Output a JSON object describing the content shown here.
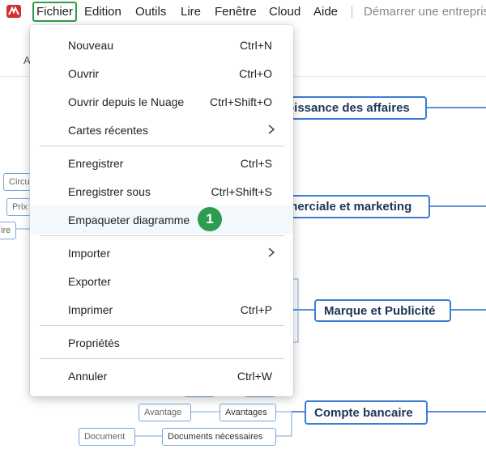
{
  "menubar": {
    "items": [
      "Fichier",
      "Edition",
      "Outils",
      "Lire",
      "Fenêtre",
      "Cloud",
      "Aide"
    ],
    "startup_text": "Démarrer une entreprise"
  },
  "toolbar": {
    "letter": "A"
  },
  "dropdown": {
    "items": [
      {
        "label": "Nouveau",
        "shortcut": "Ctrl+N"
      },
      {
        "label": "Ouvrir",
        "shortcut": "Ctrl+O"
      },
      {
        "label": "Ouvrir depuis le Nuage",
        "shortcut": "Ctrl+Shift+O"
      },
      {
        "label": "Cartes récentes",
        "shortcut": ""
      },
      {
        "label": "Enregistrer",
        "shortcut": "Ctrl+S"
      },
      {
        "label": "Enregistrer sous",
        "shortcut": "Ctrl+Shift+S"
      },
      {
        "label": "Empaqueter diagramme",
        "shortcut": ""
      },
      {
        "label": "Importer",
        "shortcut": ""
      },
      {
        "label": "Exporter",
        "shortcut": ""
      },
      {
        "label": "Imprimer",
        "shortcut": "Ctrl+P"
      },
      {
        "label": "Propriétés",
        "shortcut": ""
      },
      {
        "label": "Annuler",
        "shortcut": "Ctrl+W"
      }
    ],
    "badge": "1"
  },
  "mindmap": {
    "topic_business": "oissance des affaires",
    "topic_marketing": "merciale et marketing",
    "topic_brand": "Marque et Publicité",
    "topic_bank": "Compte bancaire",
    "leaf_circu": "Circu",
    "leaf_prix": "Prix",
    "leaf_ire": "ire",
    "leaf_avantage": "Avantage",
    "leaf_avantages": "Avantages",
    "leaf_document": "Document",
    "leaf_documents": "Documents nécessaires"
  },
  "colors": {
    "accent_green": "#2e9b4e",
    "node_blue": "#3b7dd8",
    "logo_red": "#d32f2f"
  }
}
